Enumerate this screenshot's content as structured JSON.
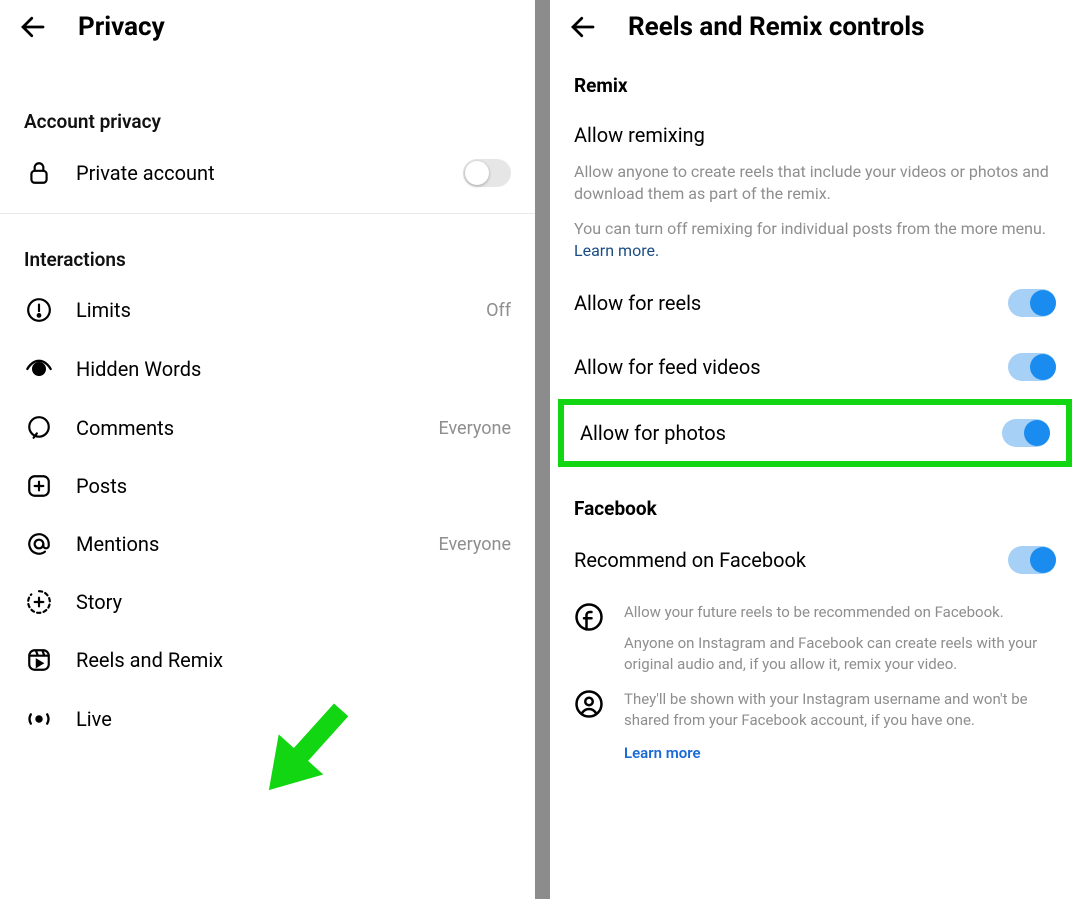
{
  "left": {
    "title": "Privacy",
    "sections": {
      "account": {
        "label": "Account privacy",
        "private_account": {
          "label": "Private account",
          "on": false
        }
      },
      "interactions": {
        "label": "Interactions",
        "items": [
          {
            "label": "Limits",
            "value": "Off"
          },
          {
            "label": "Hidden Words",
            "value": ""
          },
          {
            "label": "Comments",
            "value": "Everyone"
          },
          {
            "label": "Posts",
            "value": ""
          },
          {
            "label": "Mentions",
            "value": "Everyone"
          },
          {
            "label": "Story",
            "value": ""
          },
          {
            "label": "Reels and Remix",
            "value": ""
          },
          {
            "label": "Live",
            "value": ""
          }
        ]
      }
    }
  },
  "right": {
    "title": "Reels and Remix controls",
    "remix": {
      "heading": "Remix",
      "sub": "Allow remixing",
      "desc1": "Allow anyone to create reels that include your videos or photos and download them as part of the remix.",
      "desc2a": "You can turn off remixing for individual posts from the more menu. ",
      "learn_more": "Learn more.",
      "rows": [
        {
          "label": "Allow for reels",
          "on": true
        },
        {
          "label": "Allow for feed videos",
          "on": true
        },
        {
          "label": "Allow for photos",
          "on": true
        }
      ]
    },
    "facebook": {
      "heading": "Facebook",
      "recommend": {
        "label": "Recommend on Facebook",
        "on": true
      },
      "note1": "Allow your future reels to be recommended on Facebook.",
      "note2": "Anyone on Instagram and Facebook can create reels with your original audio and, if you allow it, remix your video.",
      "note3": "They'll be shown with your Instagram username and won't be shared from your Facebook account, if you have one.",
      "learn_more": "Learn more"
    }
  }
}
